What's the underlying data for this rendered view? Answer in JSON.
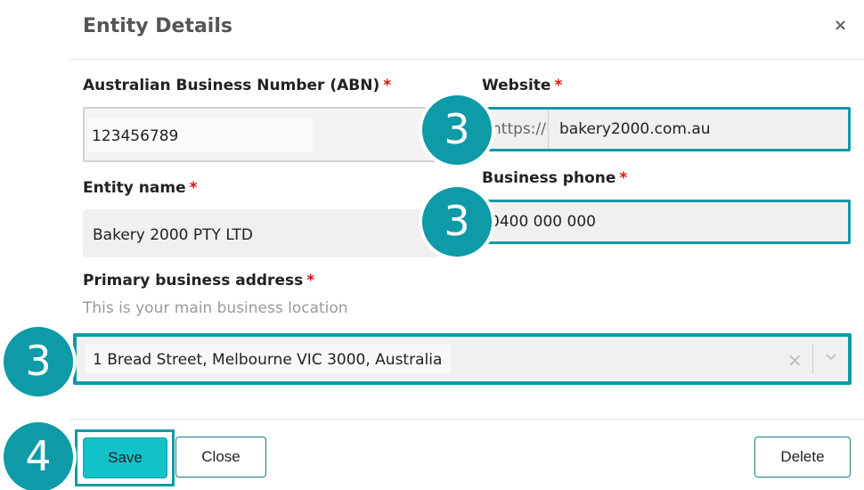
{
  "dialog": {
    "title": "Entity Details",
    "close_symbol": "×"
  },
  "fields": {
    "abn": {
      "label": "Australian Business Number (ABN)",
      "required": "*",
      "value": "123456789"
    },
    "website": {
      "label": "Website",
      "required": "*",
      "prefix": "https://",
      "value": "bakery2000.com.au"
    },
    "entity_name": {
      "label": "Entity name",
      "required": "*",
      "value": "Bakery 2000 PTY LTD"
    },
    "phone": {
      "label": "Business phone",
      "required": "*",
      "value": "0400 000 000"
    },
    "address": {
      "label": "Primary business address",
      "required": "*",
      "hint": "This is your main business location",
      "value": "1 Bread Street, Melbourne VIC 3000, Australia",
      "clear_symbol": "×"
    }
  },
  "buttons": {
    "save": "Save",
    "close": "Close",
    "delete": "Delete"
  },
  "step_badges": {
    "website": "3",
    "phone": "3",
    "address": "3",
    "save": "4"
  },
  "colors": {
    "accent": "#0e9aa7",
    "save_button": "#13c1c9",
    "required": "#d11111"
  }
}
